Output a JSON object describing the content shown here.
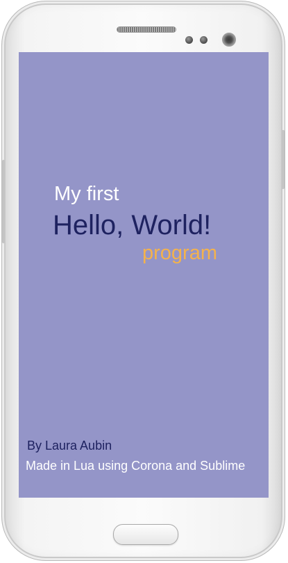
{
  "screen": {
    "background_color": "#9495c8",
    "intro_text": "My first",
    "headline_text": "Hello, World!",
    "suffix_text": "program",
    "author_text": "By Laura Aubin",
    "credits_text": "Made in Lua using Corona and Sublime"
  },
  "colors": {
    "headline": "#1e2260",
    "accent": "#f4b24c",
    "light_text": "#ffffff"
  },
  "device": {
    "icons": [
      "speaker-grille-icon",
      "proximity-sensor-icon",
      "light-sensor-icon",
      "front-camera-icon"
    ]
  }
}
